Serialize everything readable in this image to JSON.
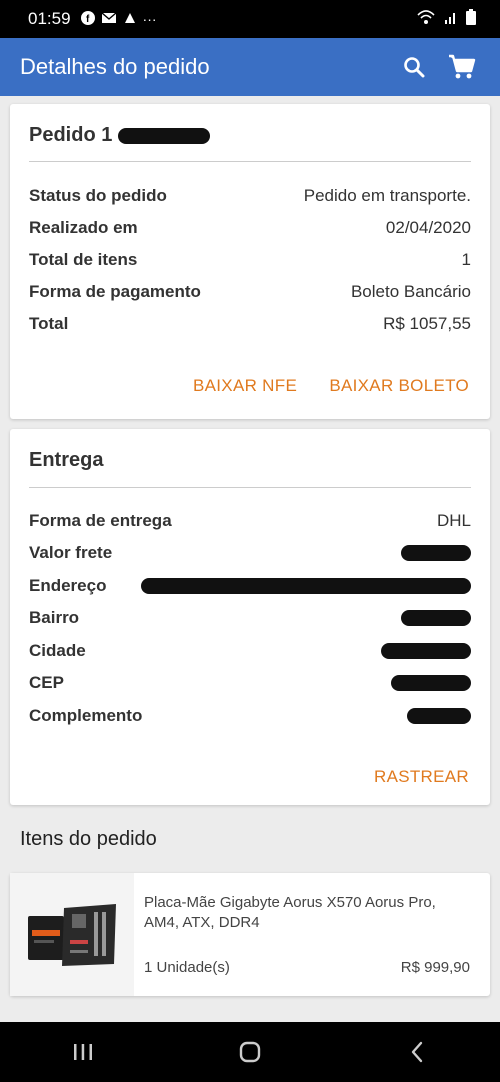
{
  "statusbar": {
    "time": "01:59",
    "more": "···"
  },
  "appbar": {
    "title": "Detalhes do pedido"
  },
  "order": {
    "title": "Pedido 1",
    "rows": [
      {
        "label": "Status do pedido",
        "value": "Pedido em transporte."
      },
      {
        "label": "Realizado em",
        "value": "02/04/2020"
      },
      {
        "label": "Total de itens",
        "value": "1"
      },
      {
        "label": "Forma de pagamento",
        "value": "Boleto Bancário"
      },
      {
        "label": "Total",
        "value": "R$ 1057,55"
      }
    ],
    "actions": {
      "nfe": "BAIXAR NFE",
      "boleto": "BAIXAR BOLETO"
    }
  },
  "delivery": {
    "title": "Entrega",
    "rows": [
      {
        "label": "Forma de entrega",
        "value": "DHL"
      },
      {
        "label": "Valor frete",
        "value": ""
      },
      {
        "label": "Endereço",
        "value": ""
      },
      {
        "label": "Bairro",
        "value": ""
      },
      {
        "label": "Cidade",
        "value": ""
      },
      {
        "label": "CEP",
        "value": ""
      },
      {
        "label": "Complemento",
        "value": ""
      }
    ],
    "action": "RASTREAR"
  },
  "items_section": {
    "title": "Itens do pedido"
  },
  "items": [
    {
      "name": "Placa-Mãe Gigabyte Aorus X570 Aorus Pro, AM4, ATX, DDR4",
      "quantity": "1 Unidade(s)",
      "price": "R$ 999,90"
    }
  ],
  "colors": {
    "appbar": "#3a6fc4",
    "accent": "#e07a1f"
  }
}
